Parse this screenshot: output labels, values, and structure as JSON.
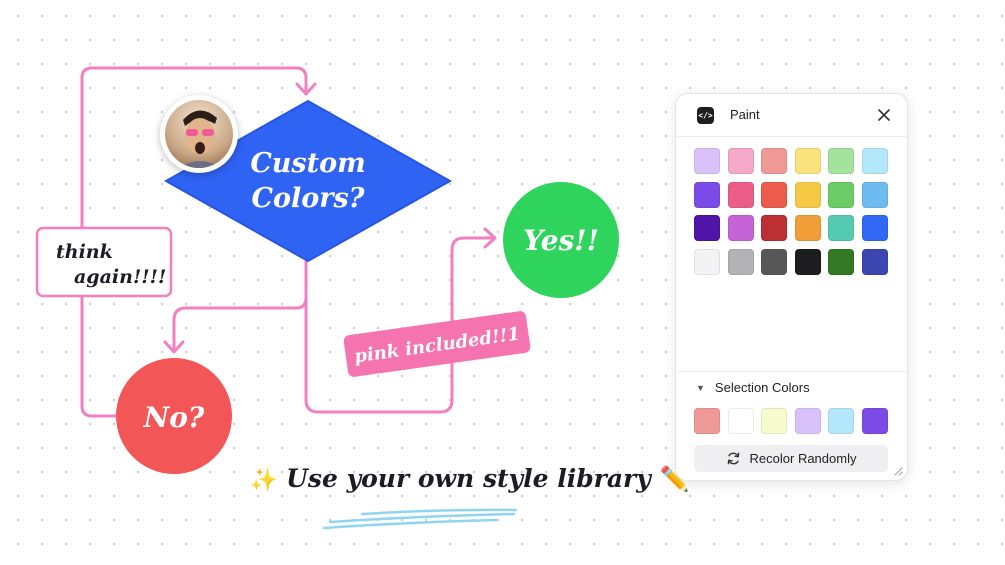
{
  "flowchart": {
    "decision_line1": "Custom",
    "decision_line2": "Colors?",
    "yes_label": "Yes!!",
    "no_label": "No?",
    "think_line1": "think",
    "think_line2": "again!!!!",
    "pink_label": "pink included!!1",
    "colors": {
      "connector": "#f47fc0",
      "decision": "#2f63f4",
      "yes": "#2fd45c",
      "no": "#f25656",
      "pink_pill": "#f573ae"
    }
  },
  "tagline": {
    "text": "Use your own style library",
    "spark_icon": "✨",
    "pencil_icon": "✏️"
  },
  "paint_panel": {
    "title": "Paint",
    "plugin_icon": "</>",
    "close_icon": "close-icon",
    "swatches": [
      [
        "#d9c2fa",
        "#f4a9c9",
        "#ef9a97",
        "#f9e27c",
        "#a3e39b",
        "#b3e7fc"
      ],
      [
        "#7c4ae6",
        "#ec5e8a",
        "#ec5b4b",
        "#f6c944",
        "#6ccc66",
        "#6ebbf0"
      ],
      [
        "#5014a8",
        "#c564d6",
        "#bc2f32",
        "#f29e38",
        "#55cab3",
        "#3169f5"
      ],
      [
        "#f3f3f5",
        "#b3b3b5",
        "#575757",
        "#1d1d1f",
        "#317a23",
        "#3c46b1"
      ]
    ],
    "selection_header": "Selection Colors",
    "selection_colors": [
      "#ef9a97",
      "#ffffff",
      "#f7fbcd",
      "#d9c2fa",
      "#b3e7fc",
      "#7c4ae6"
    ],
    "recolor_label": "Recolor Randomly"
  }
}
